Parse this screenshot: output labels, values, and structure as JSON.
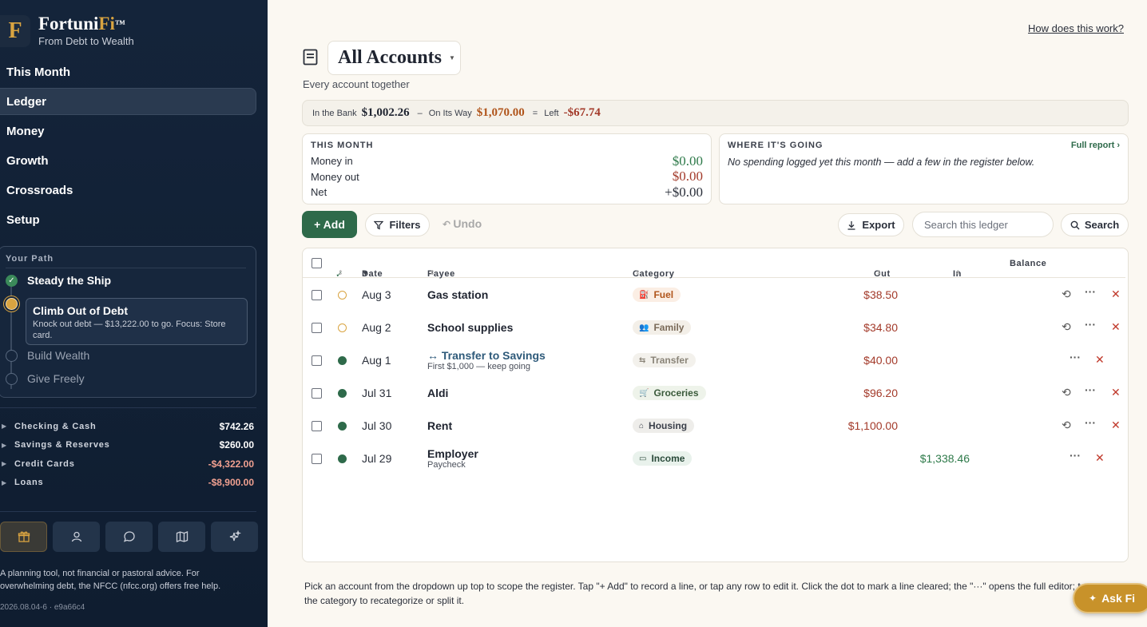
{
  "brand": {
    "logo_letter": "F",
    "name_part1": "Fortuni",
    "name_part2": "Fi",
    "trademark": "™",
    "tagline": "From Debt to Wealth"
  },
  "nav": {
    "items": [
      {
        "label": "This Month"
      },
      {
        "label": "Ledger",
        "active": true
      },
      {
        "label": "Money"
      },
      {
        "label": "Growth"
      },
      {
        "label": "Crossroads"
      },
      {
        "label": "Setup"
      }
    ]
  },
  "path": {
    "title": "Your Path",
    "steps": [
      {
        "label": "Steady the Ship",
        "state": "done",
        "check": "✓"
      },
      {
        "label": "Climb Out of Debt",
        "state": "current",
        "detail": "Knock out debt — $13,222.00 to go. Focus: Store card."
      },
      {
        "label": "Build Wealth",
        "state": "upcoming"
      },
      {
        "label": "Give Freely",
        "state": "upcoming"
      }
    ]
  },
  "account_groups": [
    {
      "name": "Checking & Cash",
      "amount": "$742.26"
    },
    {
      "name": "Savings & Reserves",
      "amount": "$260.00"
    },
    {
      "name": "Credit Cards",
      "amount": "-$4,322.00"
    },
    {
      "name": "Loans",
      "amount": "-$8,900.00"
    }
  ],
  "sidebar_icons": [
    "gift-icon",
    "person-icon",
    "chat-icon",
    "map-icon",
    "sparkle-icon"
  ],
  "disclaimer": "A planning tool, not financial or pastoral advice. For overwhelming debt, the NFCC (nfcc.org) offers free help.",
  "build": "2026.08.04-6 · e9a66c4",
  "header": {
    "how_link": "How does this work?",
    "account_select": "All Accounts",
    "account_sub": "Every account together"
  },
  "bank_bar": {
    "in_bank_label": "In the Bank",
    "in_bank_value": "$1,002.26",
    "minus": "–",
    "on_way_label": "On Its Way",
    "on_way_value": "$1,070.00",
    "equals": "=",
    "left_label": "Left",
    "left_value": "-$67.74"
  },
  "this_month": {
    "title": "THIS MONTH",
    "money_in_label": "Money in",
    "money_in": "$0.00",
    "money_out_label": "Money out",
    "money_out": "$0.00",
    "net_label": "Net",
    "net": "+$0.00"
  },
  "where_going": {
    "title": "WHERE IT'S GOING",
    "full_report": "Full report ›",
    "empty": "No spending logged yet this month — add a few in the register below."
  },
  "toolbar": {
    "add": "+ Add",
    "filters": "Filters",
    "undo": "Undo",
    "export": "Export",
    "search_placeholder": "Search this ledger",
    "search": "Search"
  },
  "table": {
    "headers": {
      "cleared": "✓",
      "date": "Date",
      "date_sort": "▼",
      "payee": "Payee",
      "category": "Category",
      "out": "Out",
      "in": "In",
      "balance": "Balance"
    },
    "rows": [
      {
        "date": "Aug 3",
        "payee": "Gas station",
        "category": "Fuel",
        "cat_icon": "⛽",
        "cat_color": "#b0541a",
        "cat_bg": "#fbeee4",
        "out": "$38.50",
        "in": "",
        "status": "open",
        "recurring": true
      },
      {
        "date": "Aug 2",
        "payee": "School supplies",
        "category": "Family",
        "cat_icon": "👥",
        "cat_color": "#7a6a58",
        "cat_bg": "#f3efe8",
        "out": "$34.80",
        "in": "",
        "status": "open",
        "recurring": true
      },
      {
        "date": "Aug 1",
        "payee": "↔ Transfer to Savings",
        "payee_sub": "First $1,000 — keep going",
        "category": "Transfer",
        "cat_icon": "⇆",
        "cat_color": "#8a8478",
        "cat_bg": "#f3f1ec",
        "out": "$40.00",
        "in": "",
        "status": "cleared",
        "recurring": false,
        "link": true
      },
      {
        "date": "Jul 31",
        "payee": "Aldi",
        "category": "Groceries",
        "cat_icon": "🛒",
        "cat_color": "#3a5a3a",
        "cat_bg": "#eef3ea",
        "out": "$96.20",
        "in": "",
        "status": "cleared",
        "recurring": true
      },
      {
        "date": "Jul 30",
        "payee": "Rent",
        "category": "Housing",
        "cat_icon": "⌂",
        "cat_color": "#3a3f4a",
        "cat_bg": "#eeedea",
        "out": "$1,100.00",
        "in": "",
        "status": "cleared",
        "recurring": true
      },
      {
        "date": "Jul 29",
        "payee": "Employer",
        "payee_sub": "Paycheck",
        "category": "Income",
        "cat_icon": "▭",
        "cat_color": "#2a4a3a",
        "cat_bg": "#e9f2ec",
        "out": "",
        "in": "$1,338.46",
        "status": "cleared",
        "recurring": false
      }
    ]
  },
  "footer_note": "Pick an account from the dropdown up top to scope the register. Tap \"+ Add\" to record a line, or tap any row to edit it. Click the dot to mark a line cleared; the \"···\" opens the full editor; tap the category to recategorize or split it.",
  "ask_fi": "Ask Fi"
}
